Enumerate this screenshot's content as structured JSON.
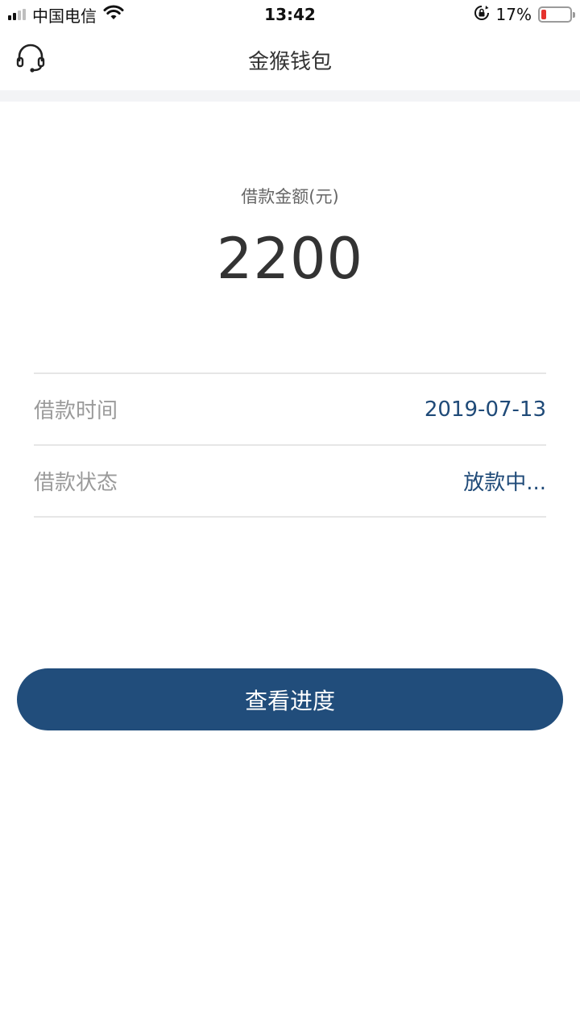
{
  "status_bar": {
    "carrier": "中国电信",
    "time": "13:42",
    "battery_percent_text": "17%",
    "battery_level": 0.17,
    "signal_bars_active": 2,
    "signal_bars_total": 4,
    "icons": [
      "signal-icon",
      "wifi-icon",
      "orientation-lock-icon",
      "battery-icon"
    ]
  },
  "header": {
    "title": "金猴钱包",
    "left_icon": "headset-icon"
  },
  "loan": {
    "amount_label": "借款金额(元)",
    "amount_value": "2200",
    "rows": [
      {
        "label": "借款时间",
        "value": "2019-07-13"
      },
      {
        "label": "借款状态",
        "value": "放款中..."
      }
    ]
  },
  "actions": {
    "view_progress_label": "查看进度"
  },
  "colors": {
    "accent": "#214d7b",
    "value_text": "#1f4a78",
    "battery_low": "#e5322d",
    "divider": "#e6e6e6",
    "band": "#f3f4f6"
  }
}
